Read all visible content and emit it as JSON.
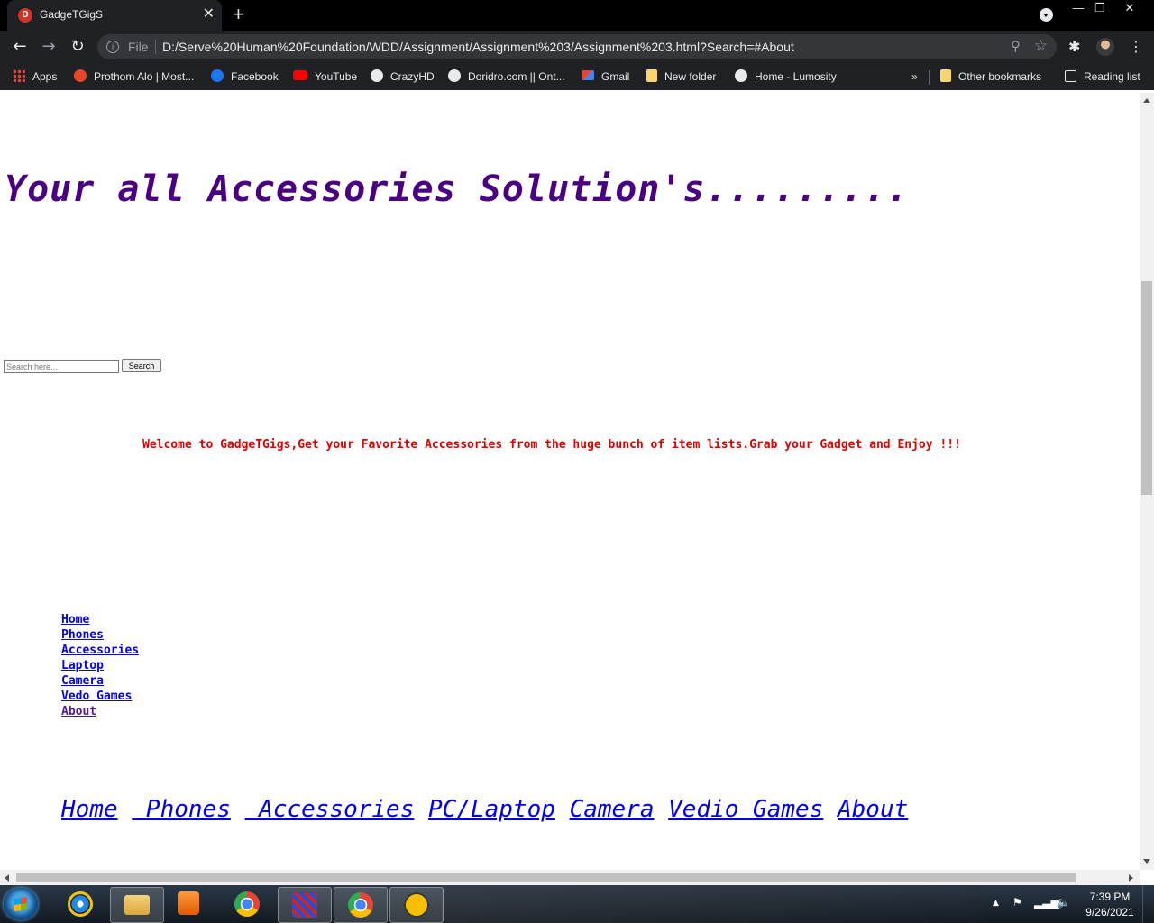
{
  "browser": {
    "tab_title": "GadgeTGigS",
    "tab_favicon_letter": "D",
    "address_scheme_label": "File",
    "address_url": "D:/Serve%20Human%20Foundation/WDD/Assignment/Assignment%203/Assignment%203.html?Search=#About",
    "bookmarks": [
      {
        "label": "Apps",
        "icon": "apps-grid-icon"
      },
      {
        "label": "Prothom Alo | Most...",
        "icon": "prothom-alo-icon"
      },
      {
        "label": "Facebook",
        "icon": "facebook-icon"
      },
      {
        "label": "YouTube",
        "icon": "youtube-icon"
      },
      {
        "label": "CrazyHD",
        "icon": "globe-icon"
      },
      {
        "label": "Doridro.com || Ont...",
        "icon": "globe-icon"
      },
      {
        "label": "Gmail",
        "icon": "gmail-icon"
      },
      {
        "label": "New folder",
        "icon": "folder-icon"
      },
      {
        "label": "Home - Lumosity",
        "icon": "globe-icon"
      }
    ],
    "overflow_label": "»",
    "other_bookmarks": "Other bookmarks",
    "reading_list": "Reading list"
  },
  "page": {
    "hero_title": "Your all Accessories Solution's.........",
    "search": {
      "placeholder": "Search here...",
      "button_label": "Search"
    },
    "welcome_text": "Welcome to GadgeTGigs,Get your Favorite Accessories from the huge bunch of item lists.Grab your Gadget and Enjoy !!!",
    "vertical_nav": [
      "Home",
      "Phones",
      "Accessories",
      "Laptop",
      "Camera",
      "Vedo Games",
      "About"
    ],
    "horizontal_nav": [
      "Home",
      " Phones",
      " Accessories",
      "PC/Laptop",
      "Camera",
      "Vedio Games",
      "About"
    ]
  },
  "taskbar": {
    "time": "7:39 PM",
    "date": "9/26/2021"
  },
  "colors": {
    "hero": "#4b0082",
    "welcome": "#e00000",
    "link": "#0000ee",
    "visited_link": "#551a8b",
    "chrome_dark": "#202124"
  }
}
